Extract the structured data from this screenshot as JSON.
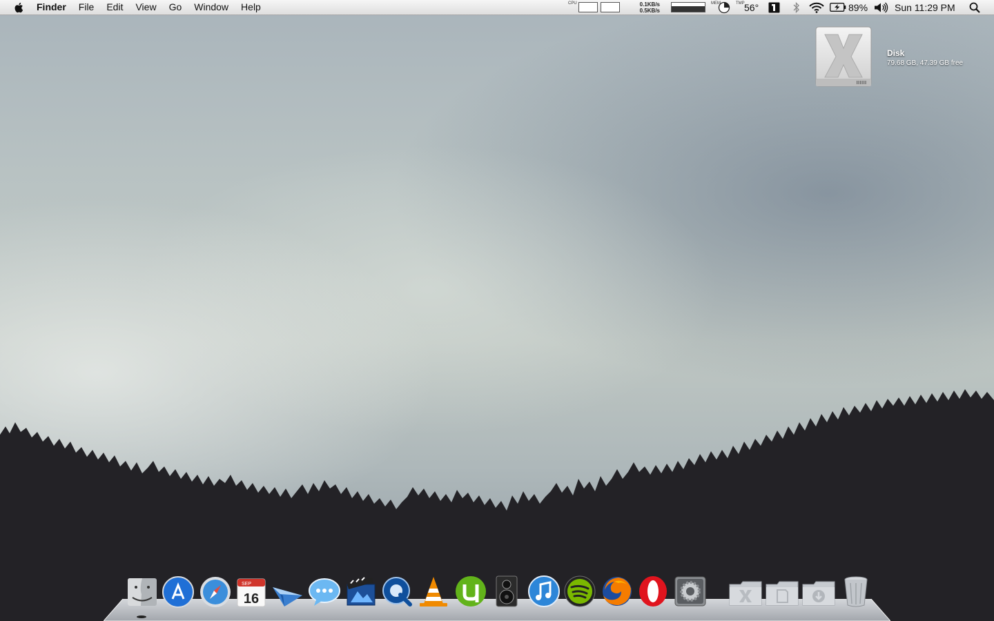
{
  "menubar": {
    "app_name": "Finder",
    "items": [
      "File",
      "Edit",
      "View",
      "Go",
      "Window",
      "Help"
    ],
    "status": {
      "cpu_label": "CPU",
      "net_up": "0.1KB/s",
      "net_down": "0.5KB/s",
      "mem_label": "MEM",
      "temp_label": "TMP",
      "temperature": "56°",
      "battery": "89%",
      "clock": "Sun 11:29 PM"
    }
  },
  "desktop": {
    "disk": {
      "name": "Disk",
      "info": "79.68 GB, 47.39 GB free"
    }
  },
  "dock": {
    "apps": [
      {
        "name": "finder-icon"
      },
      {
        "name": "app-store-icon"
      },
      {
        "name": "safari-icon"
      },
      {
        "name": "calendar-icon",
        "month": "SEP",
        "day": "16"
      },
      {
        "name": "sparrow-mail-icon"
      },
      {
        "name": "messages-icon"
      },
      {
        "name": "imovie-icon"
      },
      {
        "name": "quicktime-icon"
      },
      {
        "name": "vlc-icon"
      },
      {
        "name": "utorrent-icon"
      },
      {
        "name": "speaker-app-icon"
      },
      {
        "name": "itunes-icon"
      },
      {
        "name": "spotify-icon"
      },
      {
        "name": "firefox-icon"
      },
      {
        "name": "opera-icon"
      },
      {
        "name": "system-preferences-icon"
      }
    ],
    "stacks": [
      {
        "name": "applications-folder-icon"
      },
      {
        "name": "documents-folder-icon"
      },
      {
        "name": "downloads-folder-icon"
      },
      {
        "name": "trash-icon"
      }
    ]
  },
  "colors": {
    "menubar_bg": "#e8e8e8",
    "forest": "#232226",
    "dock_shelf": "#c9ccd0"
  }
}
